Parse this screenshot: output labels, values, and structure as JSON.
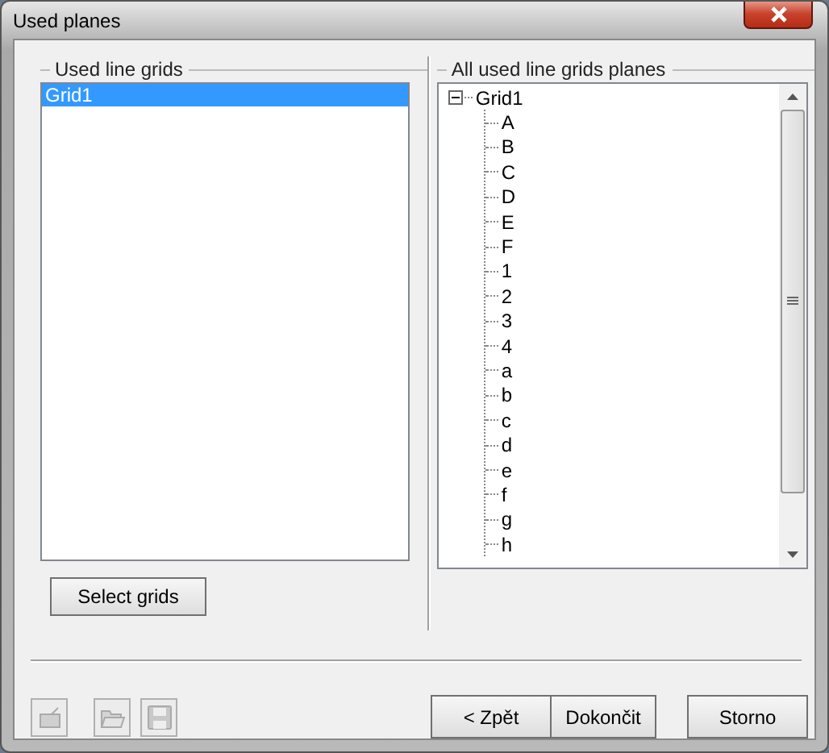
{
  "window": {
    "title": "Used planes"
  },
  "left_group": {
    "title": "Used line grids",
    "items": [
      {
        "label": "Grid1",
        "selected": true
      }
    ],
    "button": "Select grids"
  },
  "right_group": {
    "title": "All used line grids planes",
    "tree": [
      {
        "label": "Grid1",
        "expanded": true,
        "children": [
          {
            "label": "A"
          },
          {
            "label": "B"
          },
          {
            "label": "C"
          },
          {
            "label": "D"
          },
          {
            "label": "E"
          },
          {
            "label": "F"
          },
          {
            "label": "1"
          },
          {
            "label": "2"
          },
          {
            "label": "3"
          },
          {
            "label": "4"
          },
          {
            "label": "a"
          },
          {
            "label": "b"
          },
          {
            "label": "c"
          },
          {
            "label": "d"
          },
          {
            "label": "e"
          },
          {
            "label": "f"
          },
          {
            "label": "g"
          },
          {
            "label": "h"
          }
        ]
      }
    ]
  },
  "buttons": [
    {
      "label": "< Zpět"
    },
    {
      "label": "Dokončit"
    },
    {
      "label": "Storno"
    }
  ]
}
